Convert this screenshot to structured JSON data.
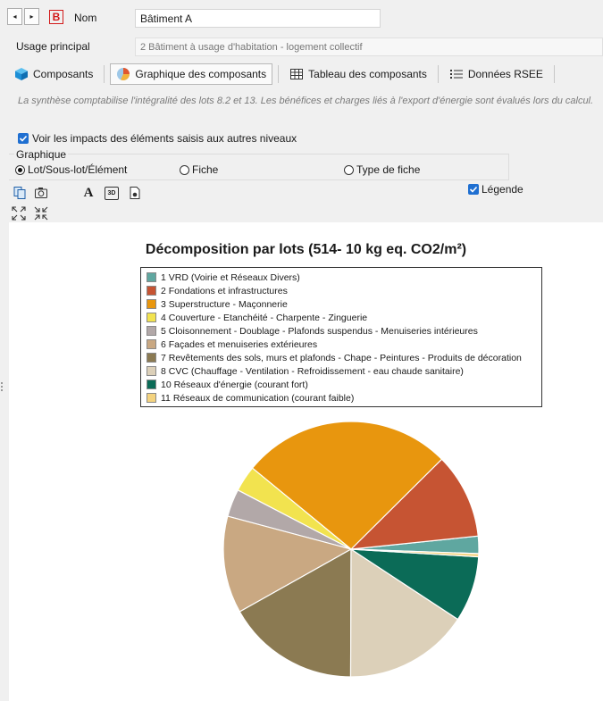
{
  "header": {
    "nav_prev": "◂",
    "nav_next": "▸",
    "badge": "B",
    "nom_label": "Nom",
    "nom_value": "Bâtiment A",
    "usage_label": "Usage principal",
    "usage_value": "2 Bâtiment à usage d'habitation - logement collectif"
  },
  "tabs": [
    {
      "label": "Composants",
      "icon": "cube-icon"
    },
    {
      "label": "Graphique des composants",
      "icon": "pie-chart-icon",
      "active": true
    },
    {
      "label": "Tableau des composants",
      "icon": "table-icon"
    },
    {
      "label": "Données RSEE",
      "icon": "list-icon"
    }
  ],
  "info_text": "La synthèse comptabilise l'intégralité des lots 8.2 et 13. Les bénéfices et charges liés à l'export d'énergie sont évalués lors du calcul.",
  "options": {
    "show_impacts_label": "Voir les impacts des éléments saisis aux autres niveaux",
    "show_impacts_checked": true,
    "group_label": "Graphique",
    "radios": [
      {
        "label": "Lot/Sous-lot/Élément",
        "selected": true
      },
      {
        "label": "Fiche",
        "selected": false
      },
      {
        "label": "Type de fiche",
        "selected": false
      }
    ],
    "legend_label": "Légende",
    "legend_checked": true
  },
  "toolbar": {
    "font_glyph": "A",
    "three_d_label": "3D"
  },
  "chart_data": {
    "type": "pie",
    "title": "Décomposition par lots (514- 10 kg eq. CO2/m²)",
    "legend_position": "top",
    "slices": [
      {
        "label": "1 VRD (Voirie et Réseaux Divers)",
        "value": 2.2,
        "color": "#5fa7a0"
      },
      {
        "label": "2 Fondations et infrastructures",
        "value": 10.8,
        "color": "#c65433"
      },
      {
        "label": "3 Superstructure - Maçonnerie",
        "value": 26.6,
        "color": "#e8960e"
      },
      {
        "label": "4 Couverture - Etanchéité - Charpente - Zinguerie",
        "value": 3.3,
        "color": "#f2e34f"
      },
      {
        "label": "5 Cloisonnement - Doublage - Plafonds suspendus - Menuiseries intérieures",
        "value": 3.5,
        "color": "#b2a8a8"
      },
      {
        "label": "6 Façades et menuiseries extérieures",
        "value": 12.3,
        "color": "#c9a882"
      },
      {
        "label": "7 Revêtements des sols, murs et plafonds - Chape - Peintures - Produits de décoration",
        "value": 16.8,
        "color": "#8b7a52"
      },
      {
        "label": "8 CVC (Chauffage - Ventilation - Refroidissement - eau chaude sanitaire)",
        "value": 15.8,
        "color": "#dcd0b9"
      },
      {
        "label": "10 Réseaux d'énergie (courant fort)",
        "value": 8.3,
        "color": "#0b6b57"
      },
      {
        "label": "11 Réseaux de communication (courant faible)",
        "value": 0.4,
        "color": "#f4d37f"
      }
    ]
  }
}
